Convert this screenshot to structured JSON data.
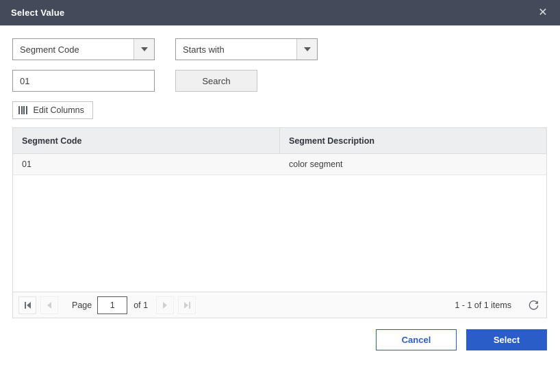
{
  "dialog": {
    "title": "Select Value",
    "close_icon": "close-icon"
  },
  "filters": {
    "field_select": {
      "value": "Segment Code",
      "arrow_icon": "chevron-down-icon"
    },
    "operator_select": {
      "value": "Starts with",
      "arrow_icon": "chevron-down-icon"
    },
    "search_input": {
      "value": "01",
      "placeholder": ""
    },
    "search_button": "Search"
  },
  "toolbar": {
    "edit_columns_label": "Edit Columns",
    "edit_columns_icon": "columns-icon"
  },
  "grid": {
    "columns": [
      {
        "label": "Segment Code"
      },
      {
        "label": "Segment Description"
      }
    ],
    "rows": [
      {
        "code": "01",
        "description": "color segment"
      }
    ]
  },
  "pager": {
    "first_icon": "first-page-icon",
    "prev_icon": "previous-page-icon",
    "page_label": "Page",
    "page_value": "1",
    "of_label": "of 1",
    "next_icon": "next-page-icon",
    "last_icon": "last-page-icon",
    "items_summary": "1 - 1 of 1 items",
    "refresh_icon": "refresh-icon"
  },
  "footer": {
    "cancel_label": "Cancel",
    "select_label": "Select"
  },
  "colors": {
    "titlebar_background": "#434a5a",
    "primary_blue": "#2b5dc9",
    "grid_header_background": "#eceef0",
    "row_background": "#f8f8f8"
  }
}
